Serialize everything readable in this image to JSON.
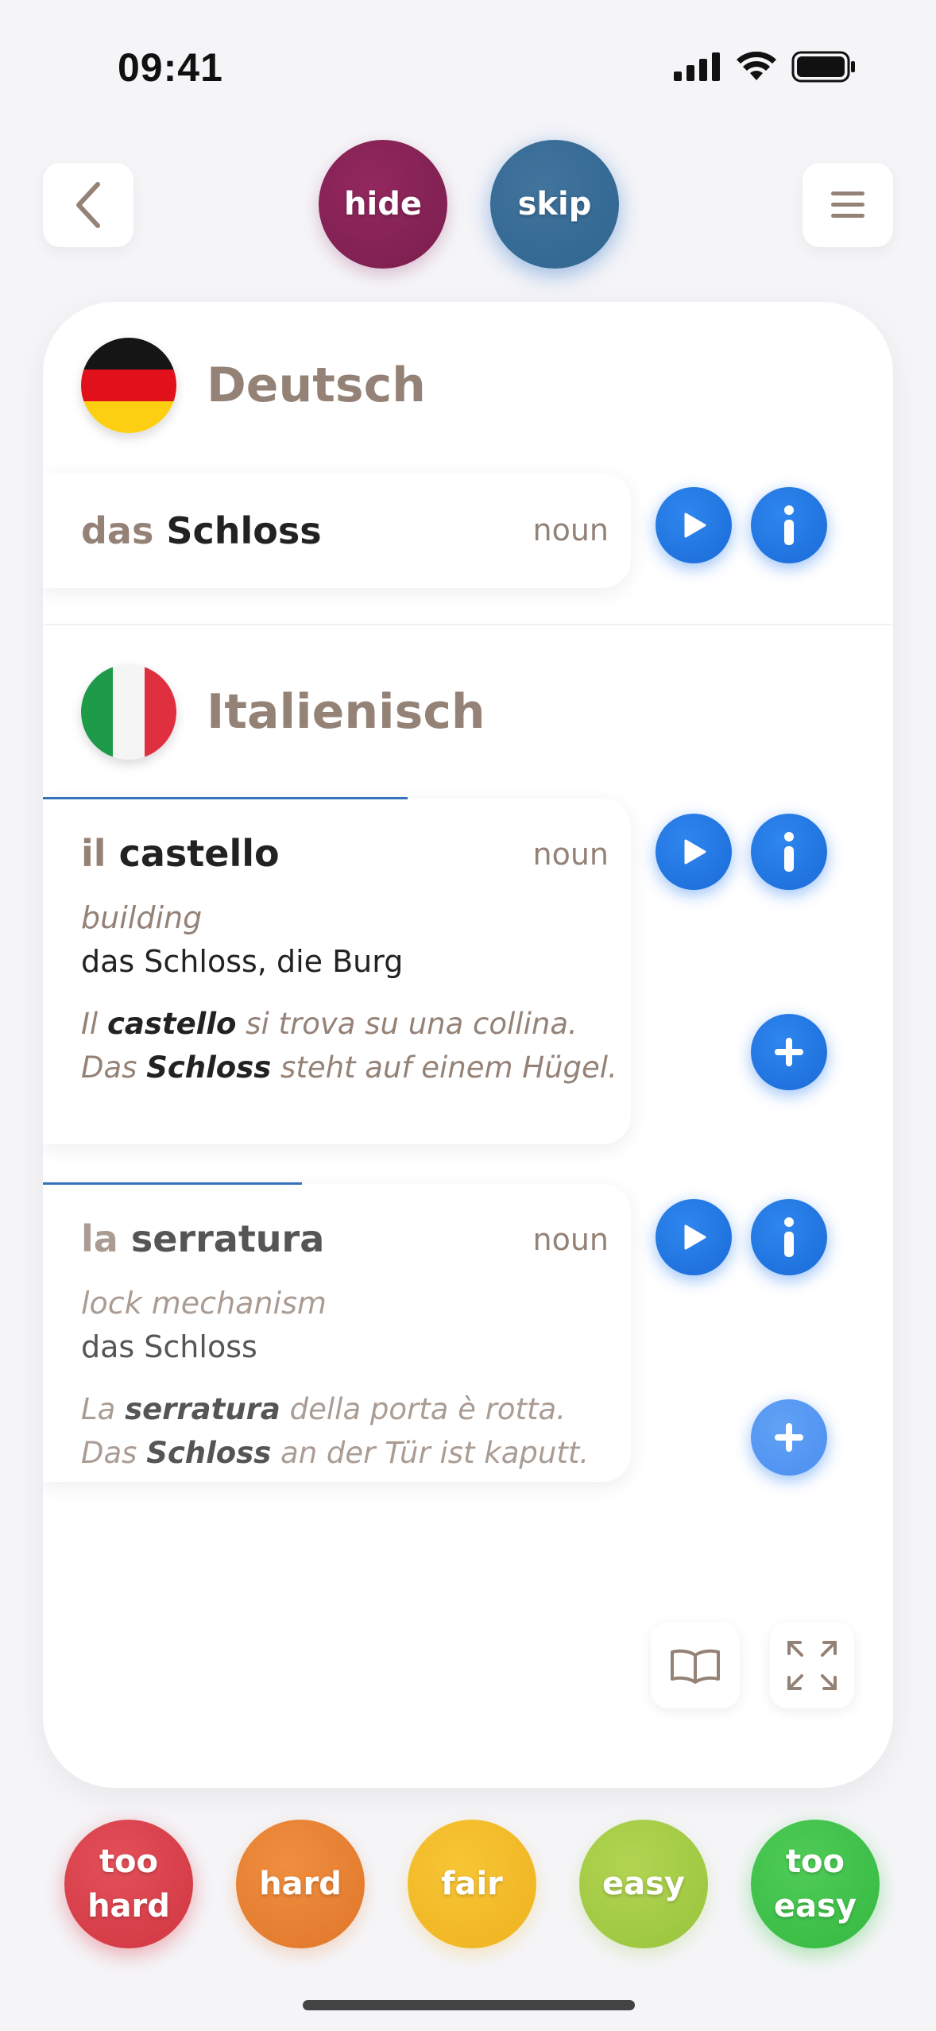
{
  "status_bar": {
    "time": "09:41"
  },
  "top": {
    "hide_label": "hide",
    "skip_label": "skip"
  },
  "source": {
    "language": "Deutsch",
    "entry": {
      "article": "das",
      "word": "Schloss",
      "pos": "noun"
    }
  },
  "target": {
    "language": "Italienisch",
    "entries": [
      {
        "article": "il",
        "word": "castello",
        "pos": "noun",
        "sense": "building",
        "translation": "das Schloss, die Burg",
        "example_it": {
          "pre": "Il ",
          "bold": "castello",
          "post": " si trova su una collina."
        },
        "example_de": {
          "pre": "Das ",
          "bold": "Schloss",
          "post": " steht auf einem Hügel."
        },
        "progress": 0.62
      },
      {
        "article": "la",
        "word": "serratura",
        "pos": "noun",
        "sense": "lock mechanism",
        "translation": "das Schloss",
        "example_it": {
          "pre": "La ",
          "bold": "serratura",
          "post": " della porta è rotta."
        },
        "example_de": {
          "pre": "Das ",
          "bold": "Schloss",
          "post": " an der Tür ist kaputt."
        },
        "progress": 0.44
      }
    ]
  },
  "rating": [
    {
      "line1": "too",
      "line2": "hard",
      "color": "#d93a44"
    },
    {
      "line1": "hard",
      "line2": "",
      "color": "#e67e2c"
    },
    {
      "line1": "fair",
      "line2": "",
      "color": "#f2b82a"
    },
    {
      "line1": "easy",
      "line2": "",
      "color": "#a3cc44"
    },
    {
      "line1": "too",
      "line2": "easy",
      "color": "#3fc24a"
    }
  ],
  "icons": {
    "back": "chevron-left-icon",
    "menu": "hamburger-menu-icon",
    "play": "play-icon",
    "info": "info-icon",
    "add": "plus-icon",
    "book": "open-book-icon",
    "expand": "expand-icon"
  },
  "colors": {
    "accent": "#1a6bd8",
    "label": "#958277",
    "hide": "#7a1e4e",
    "skip": "#2f6590"
  }
}
